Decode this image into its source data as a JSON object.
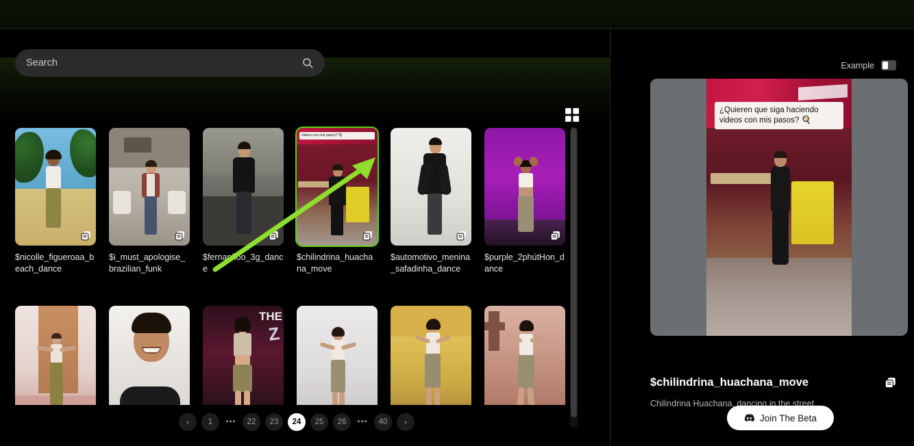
{
  "search": {
    "placeholder": "Search",
    "value": "",
    "icon": "search-icon"
  },
  "toolbar": {
    "grid_view_icon": "grid-view-icon"
  },
  "gallery": {
    "rows": [
      [
        {
          "label": "$nicolle_figueroaa_beach_dance",
          "selected": false,
          "badge": "copy-icon"
        },
        {
          "label": "$i_must_apologise_brazilian_funk",
          "selected": false,
          "badge": "copy-icon"
        },
        {
          "label": "$fernanfloo_3g_dance",
          "selected": false,
          "badge": "copy-icon"
        },
        {
          "label": "$chilindrina_huachana_move",
          "selected": true,
          "badge": "copy-icon"
        },
        {
          "label": "$automotivo_menina_safadinha_dance",
          "selected": false,
          "badge": "copy-icon"
        },
        {
          "label": "$purple_2phútHon_dance",
          "selected": false,
          "badge": "copy-icon"
        }
      ],
      [
        {
          "label": "",
          "selected": false,
          "badge": "copy-icon"
        },
        {
          "label": "",
          "selected": false,
          "badge": "copy-icon"
        },
        {
          "label": "",
          "selected": false,
          "badge": "copy-icon"
        },
        {
          "label": "",
          "selected": false,
          "badge": "copy-icon"
        },
        {
          "label": "",
          "selected": false,
          "badge": "copy-icon"
        },
        {
          "label": "",
          "selected": false,
          "badge": "copy-icon"
        }
      ]
    ]
  },
  "pagination": {
    "prev": "‹",
    "next": "›",
    "items": [
      "1",
      "•••",
      "22",
      "23",
      "24",
      "25",
      "26",
      "•••",
      "40"
    ],
    "active": "24"
  },
  "preview": {
    "example_label": "Example",
    "toggle_state": "off",
    "video_caption": "¿Quieren que siga haciendo videos con mis pasos? 🍳",
    "title": "$chilindrina_huachana_move",
    "description": "Chilindrina Huachana, dancing in the street",
    "copy_icon": "copy-icon",
    "cta_label": "Join The Beta",
    "cta_icon": "discord-icon"
  },
  "colors": {
    "background": "#000000",
    "search_field": "#2b2b2b",
    "selection_green": "#57d21b",
    "active_page_bg": "#ffffff",
    "cta_bg": "#ffffff"
  }
}
